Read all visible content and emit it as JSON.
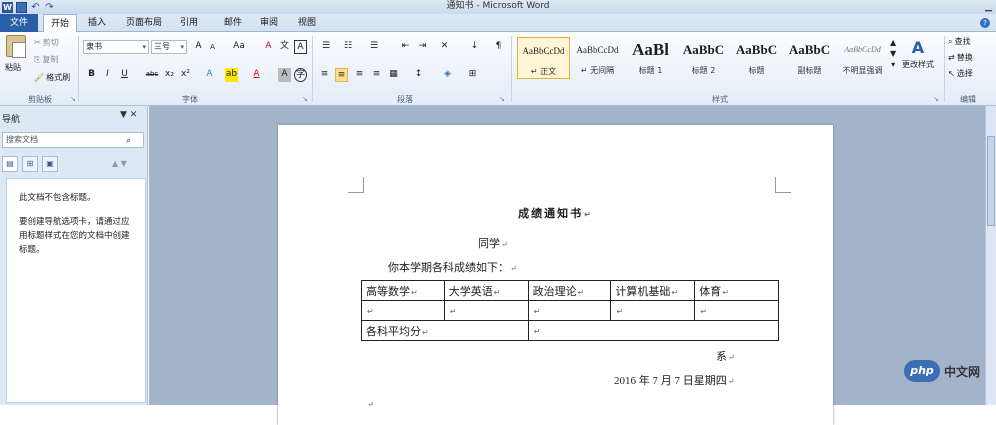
{
  "window": {
    "title": "通知书 - Microsoft Word",
    "minimize": "▁"
  },
  "tabs": [
    {
      "label": "文件"
    },
    {
      "label": "开始"
    },
    {
      "label": "插入"
    },
    {
      "label": "页面布局"
    },
    {
      "label": "引用"
    },
    {
      "label": "邮件"
    },
    {
      "label": "审阅"
    },
    {
      "label": "视图"
    }
  ],
  "ribbon": {
    "clipboard": {
      "paste": "粘贴",
      "cut": "剪切",
      "copy": "复制",
      "format_painter": "格式刷",
      "label": "剪贴板"
    },
    "font": {
      "name": "隶书",
      "size": "三号",
      "label": "字体",
      "grow": "A",
      "shrink": "A",
      "case": "Aa",
      "clear": "A",
      "bold": "B",
      "italic": "I",
      "underline": "U",
      "strike": "abc",
      "sub": "x₂",
      "sup": "x²"
    },
    "paragraph": {
      "label": "段落"
    },
    "styles": {
      "label": "样式",
      "items": [
        {
          "sample": "AaBbCcDd",
          "name": "↵ 正文"
        },
        {
          "sample": "AaBbCcDd",
          "name": "↵ 无间隔"
        },
        {
          "sample": "AaBl",
          "name": "标题 1"
        },
        {
          "sample": "AaBbC",
          "name": "标题 2"
        },
        {
          "sample": "AaBbC",
          "name": "标题"
        },
        {
          "sample": "AaBbC",
          "name": "副标题"
        },
        {
          "sample": "AaBbCcDd",
          "name": "不明显强调"
        }
      ],
      "change": "更改样式"
    },
    "editing": {
      "find": "查找",
      "replace": "替换",
      "select": "选择",
      "label": "编辑"
    }
  },
  "nav": {
    "title": "导航",
    "search_placeholder": "搜索文档",
    "message1": "此文档不包含标题。",
    "message2": "要创建导航选项卡，请通过应用标题样式在您的文档中创建标题。"
  },
  "document": {
    "title": "成绩通知书",
    "greeting": "同学",
    "intro": "你本学期各科成绩如下：",
    "table_headers": [
      "高等数学",
      "大学英语",
      "政治理论",
      "计算机基础",
      "体育"
    ],
    "average_label": "各科平均分",
    "dept": "系",
    "date": "2016 年 7 月 7 日星期四",
    "para_mark": "↵"
  },
  "watermark": {
    "logo": "php",
    "text": "中文网"
  }
}
